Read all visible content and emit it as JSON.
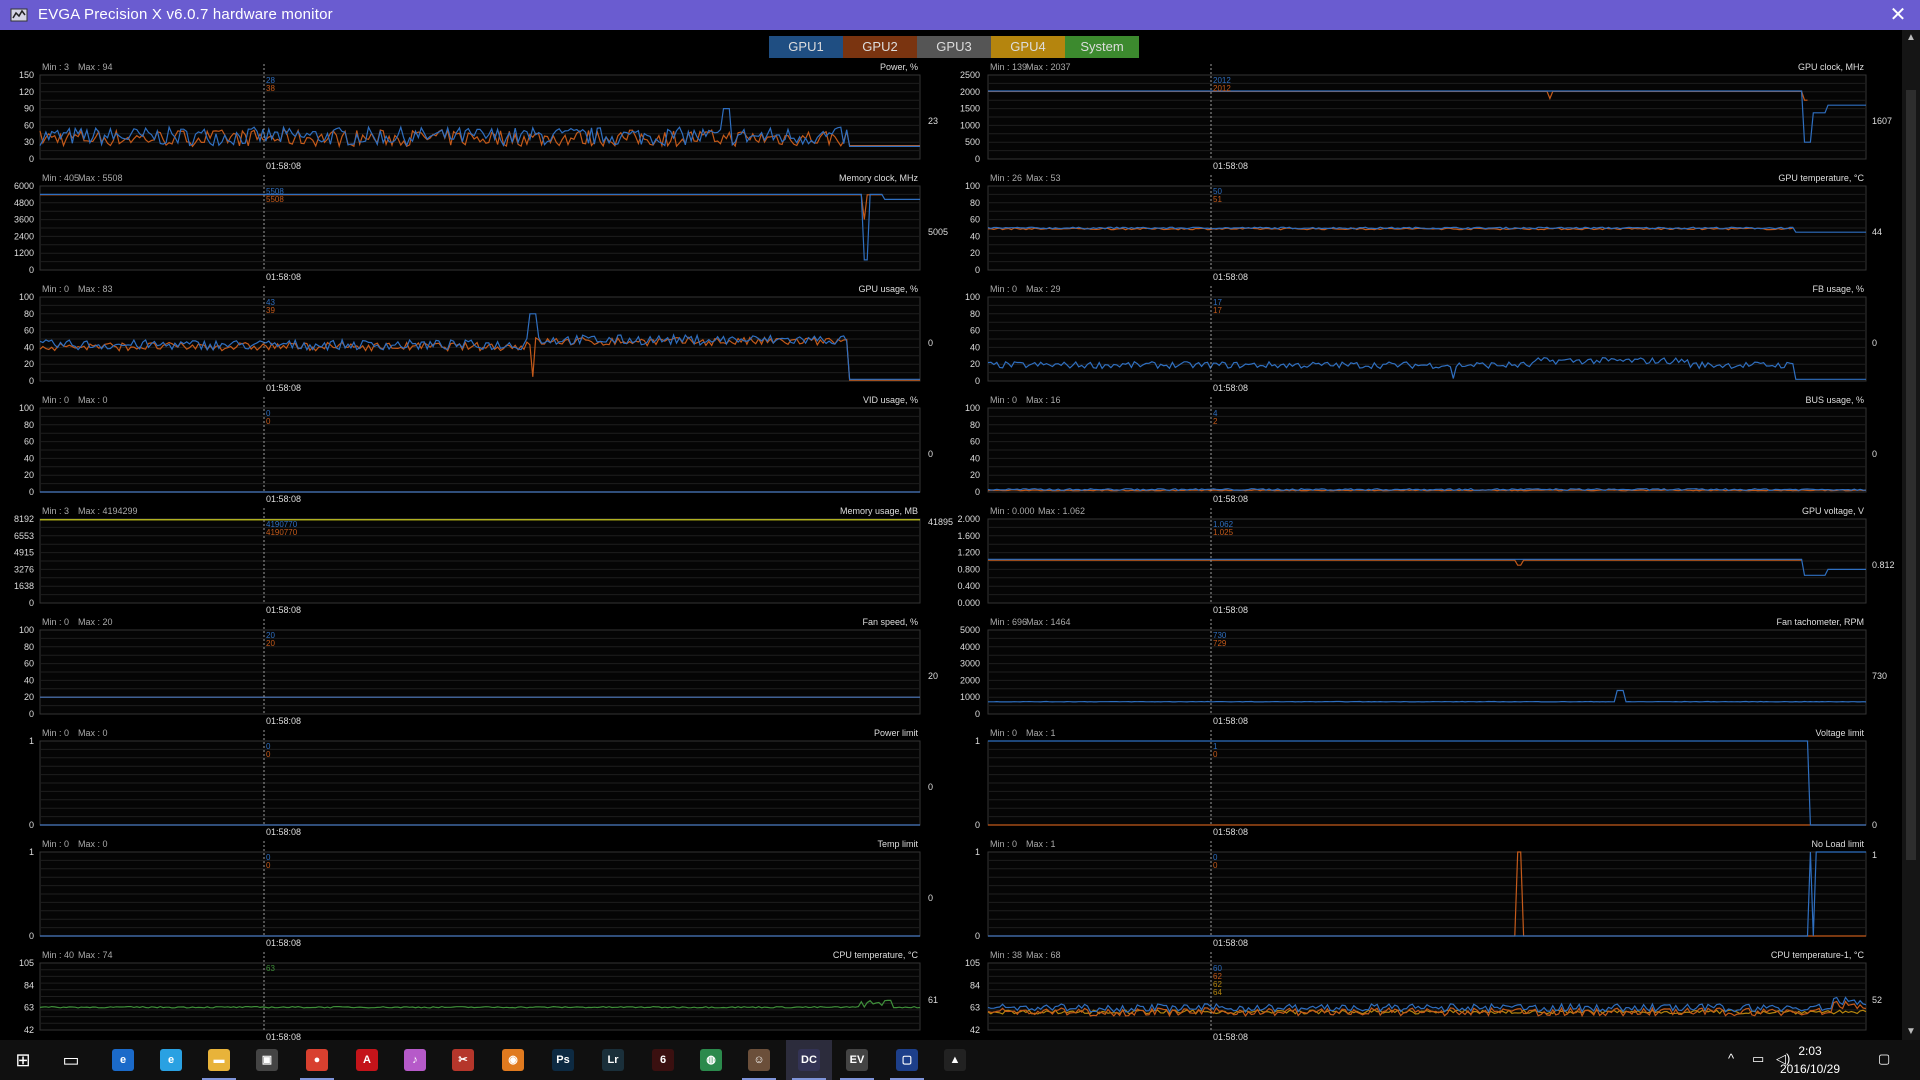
{
  "window": {
    "title": "EVGA Precision X v6.0.7 hardware monitor",
    "close_glyph": "✕"
  },
  "tabs": [
    {
      "label": "GPU1",
      "color": "#1f4e82"
    },
    {
      "label": "GPU2",
      "color": "#7a3410"
    },
    {
      "label": "GPU3",
      "color": "#555555"
    },
    {
      "label": "GPU4",
      "color": "#b5850e"
    },
    {
      "label": "System",
      "color": "#3c8a2e"
    }
  ],
  "colors": {
    "gpu1": "#2f6fc0",
    "gpu2": "#c45a1a",
    "system": "#3f8f3a",
    "memory_line": "#d9d91a",
    "grid": "#1e1e1e",
    "frame": "#333333",
    "cursor": "#9a9a9a"
  },
  "cursor_time": "01:58:08",
  "charts": [
    {
      "title": "Power, %",
      "min_label": "Min : 3",
      "max_label": "Max : 94",
      "ticks": [
        "150",
        "120",
        "90",
        "60",
        "30",
        "0"
      ],
      "tip_values": [
        "28",
        "38"
      ],
      "current": "23",
      "shape": "power",
      "ylim": [
        0,
        150
      ]
    },
    {
      "title": "GPU clock, MHz",
      "min_label": "Min : 139",
      "max_label": "Max : 2037",
      "ticks": [
        "2500",
        "2000",
        "1500",
        "1000",
        "500",
        "0"
      ],
      "tip_values": [
        "2012",
        "2012"
      ],
      "current": "1607",
      "shape": "clock",
      "ylim": [
        0,
        2500
      ]
    },
    {
      "title": "Memory clock, MHz",
      "min_label": "Min : 405",
      "max_label": "Max : 5508",
      "ticks": [
        "6000",
        "4800",
        "3600",
        "2400",
        "1200",
        "0"
      ],
      "tip_values": [
        "5508",
        "5508"
      ],
      "current": "5005",
      "shape": "memclock",
      "ylim": [
        0,
        6000
      ]
    },
    {
      "title": "GPU temperature, °C",
      "min_label": "Min : 26",
      "max_label": "Max : 53",
      "ticks": [
        "100",
        "80",
        "60",
        "40",
        "20",
        "0"
      ],
      "tip_values": [
        "50",
        "51"
      ],
      "current": "44",
      "shape": "gputemp",
      "ylim": [
        0,
        100
      ]
    },
    {
      "title": "GPU usage, %",
      "min_label": "Min : 0",
      "max_label": "Max : 83",
      "ticks": [
        "100",
        "80",
        "60",
        "40",
        "20",
        "0"
      ],
      "tip_values": [
        "43",
        "39"
      ],
      "current": "0",
      "shape": "usage",
      "ylim": [
        0,
        100
      ]
    },
    {
      "title": "FB usage, %",
      "min_label": "Min : 0",
      "max_label": "Max : 29",
      "ticks": [
        "100",
        "80",
        "60",
        "40",
        "20",
        "0"
      ],
      "tip_values": [
        "17",
        "17"
      ],
      "current": "0",
      "shape": "fb",
      "ylim": [
        0,
        100
      ]
    },
    {
      "title": "VID usage, %",
      "min_label": "Min : 0",
      "max_label": "Max : 0",
      "ticks": [
        "100",
        "80",
        "60",
        "40",
        "20",
        "0"
      ],
      "tip_values": [
        "0",
        "0"
      ],
      "current": "0",
      "shape": "flat0",
      "ylim": [
        0,
        100
      ]
    },
    {
      "title": "BUS usage, %",
      "min_label": "Min : 0",
      "max_label": "Max : 16",
      "ticks": [
        "100",
        "80",
        "60",
        "40",
        "20",
        "0"
      ],
      "tip_values": [
        "4",
        "2"
      ],
      "current": "0",
      "shape": "bus",
      "ylim": [
        0,
        100
      ]
    },
    {
      "title": "Memory usage, MB",
      "min_label": "Min : 3",
      "max_label": "Max : 4194299",
      "ticks": [
        "8192",
        "6553",
        "4915",
        "3276",
        "1638",
        "0"
      ],
      "tip_values": [
        "4190770",
        "4190770"
      ],
      "current": "41895",
      "shape": "memusage",
      "ylim": [
        0,
        8192
      ]
    },
    {
      "title": "GPU voltage, V",
      "min_label": "Min : 0.000",
      "max_label": "Max : 1.062",
      "ticks": [
        "2.000",
        "1.600",
        "1.200",
        "0.800",
        "0.400",
        "0.000"
      ],
      "tip_values": [
        "1.062",
        "1.025"
      ],
      "current": "0.812",
      "shape": "voltage",
      "ylim": [
        0,
        2
      ]
    },
    {
      "title": "Fan speed, %",
      "min_label": "Min : 0",
      "max_label": "Max : 20",
      "ticks": [
        "100",
        "80",
        "60",
        "40",
        "20",
        "0"
      ],
      "tip_values": [
        "20",
        "20"
      ],
      "current": "20",
      "shape": "fan",
      "ylim": [
        0,
        100
      ]
    },
    {
      "title": "Fan tachometer, RPM",
      "min_label": "Min : 696",
      "max_label": "Max : 1464",
      "ticks": [
        "5000",
        "4000",
        "3000",
        "2000",
        "1000",
        "0"
      ],
      "tip_values": [
        "730",
        "729"
      ],
      "current": "730",
      "shape": "tach",
      "ylim": [
        0,
        5000
      ]
    },
    {
      "title": "Power limit",
      "min_label": "Min : 0",
      "max_label": "Max : 0",
      "ticks": [
        "1",
        "",
        "",
        "",
        "",
        "0"
      ],
      "tip_values": [
        "0",
        "0"
      ],
      "current": "0",
      "shape": "flat0",
      "ylim": [
        0,
        1
      ]
    },
    {
      "title": "Voltage limit",
      "min_label": "Min : 0",
      "max_label": "Max : 1",
      "ticks": [
        "1",
        "",
        "",
        "",
        "",
        "0"
      ],
      "tip_values": [
        "1",
        "0"
      ],
      "current": "0",
      "shape": "vlimit",
      "ylim": [
        0,
        1
      ]
    },
    {
      "title": "Temp limit",
      "min_label": "Min : 0",
      "max_label": "Max : 0",
      "ticks": [
        "1",
        "",
        "",
        "",
        "",
        "0"
      ],
      "tip_values": [
        "0",
        "0"
      ],
      "current": "0",
      "shape": "flat0",
      "ylim": [
        0,
        1
      ]
    },
    {
      "title": "No Load limit",
      "min_label": "Min : 0",
      "max_label": "Max : 1",
      "ticks": [
        "1",
        "",
        "",
        "",
        "",
        "0"
      ],
      "tip_values": [
        "0",
        "0"
      ],
      "current": "1",
      "shape": "noload",
      "ylim": [
        0,
        1
      ]
    },
    {
      "title": "CPU temperature, °C",
      "min_label": "Min : 40",
      "max_label": "Max : 74",
      "ticks": [
        "105",
        "84",
        "63",
        "42"
      ],
      "tip_values": [
        "63"
      ],
      "current": "61",
      "shape": "cputemp",
      "ylim": [
        42,
        105
      ]
    },
    {
      "title": "CPU temperature-1, °C",
      "min_label": "Min : 38",
      "max_label": "Max : 68",
      "ticks": [
        "105",
        "84",
        "63",
        "42"
      ],
      "tip_values": [
        "60",
        "62",
        "62",
        "64"
      ],
      "current": "52",
      "shape": "cputemp1",
      "ylim": [
        42,
        105
      ]
    }
  ],
  "taskbar": {
    "items": [
      {
        "name": "start-icon",
        "glyph": "⊞",
        "bg": "transparent",
        "running": false
      },
      {
        "name": "task-view-icon",
        "glyph": "▭",
        "bg": "transparent",
        "running": false
      },
      {
        "name": "edge-icon",
        "glyph": "e",
        "bg": "#1b6ac9",
        "running": false
      },
      {
        "name": "internet-explorer-icon",
        "glyph": "e",
        "bg": "#2aa1e2",
        "running": false
      },
      {
        "name": "file-explorer-icon",
        "glyph": "▬",
        "bg": "#e8b33a",
        "running": true
      },
      {
        "name": "store-icon",
        "glyph": "▣",
        "bg": "#444444",
        "running": false
      },
      {
        "name": "chrome-icon",
        "glyph": "●",
        "bg": "#d8402f",
        "running": true
      },
      {
        "name": "adobe-reader-icon",
        "glyph": "A",
        "bg": "#c4141a",
        "running": false
      },
      {
        "name": "itunes-icon",
        "glyph": "♪",
        "bg": "#b65ac9",
        "running": false
      },
      {
        "name": "tools-icon",
        "glyph": "✂",
        "bg": "#b5362b",
        "running": false
      },
      {
        "name": "camera-app-icon",
        "glyph": "◉",
        "bg": "#e07a1f",
        "running": false
      },
      {
        "name": "photoshop-icon",
        "glyph": "Ps",
        "bg": "#0d2a42",
        "running": false
      },
      {
        "name": "lightroom-icon",
        "glyph": "Lr",
        "bg": "#1a2f3a",
        "running": false
      },
      {
        "name": "benchmark-icon",
        "glyph": "6",
        "bg": "#3a1010",
        "running": false
      },
      {
        "name": "network-globe-icon",
        "glyph": "◍",
        "bg": "#2b8a4c",
        "running": false
      },
      {
        "name": "game-app-icon",
        "glyph": "☺",
        "bg": "#6b4f3a",
        "running": true
      },
      {
        "name": "precision-x-icon",
        "glyph": "DC",
        "bg": "#333355",
        "running": true,
        "active": true
      },
      {
        "name": "evga-app-icon",
        "glyph": "EV",
        "bg": "#444444",
        "running": true
      },
      {
        "name": "monitor-app-icon",
        "glyph": "▢",
        "bg": "#1d3f8a",
        "running": true
      },
      {
        "name": "flight-sim-icon",
        "glyph": "▲",
        "bg": "#222222",
        "running": false
      }
    ],
    "tray": {
      "chevron": "^",
      "network": "▭",
      "volume": "◁)",
      "time": "2:03",
      "date": "2016/10/29",
      "notifications": "▢"
    }
  }
}
